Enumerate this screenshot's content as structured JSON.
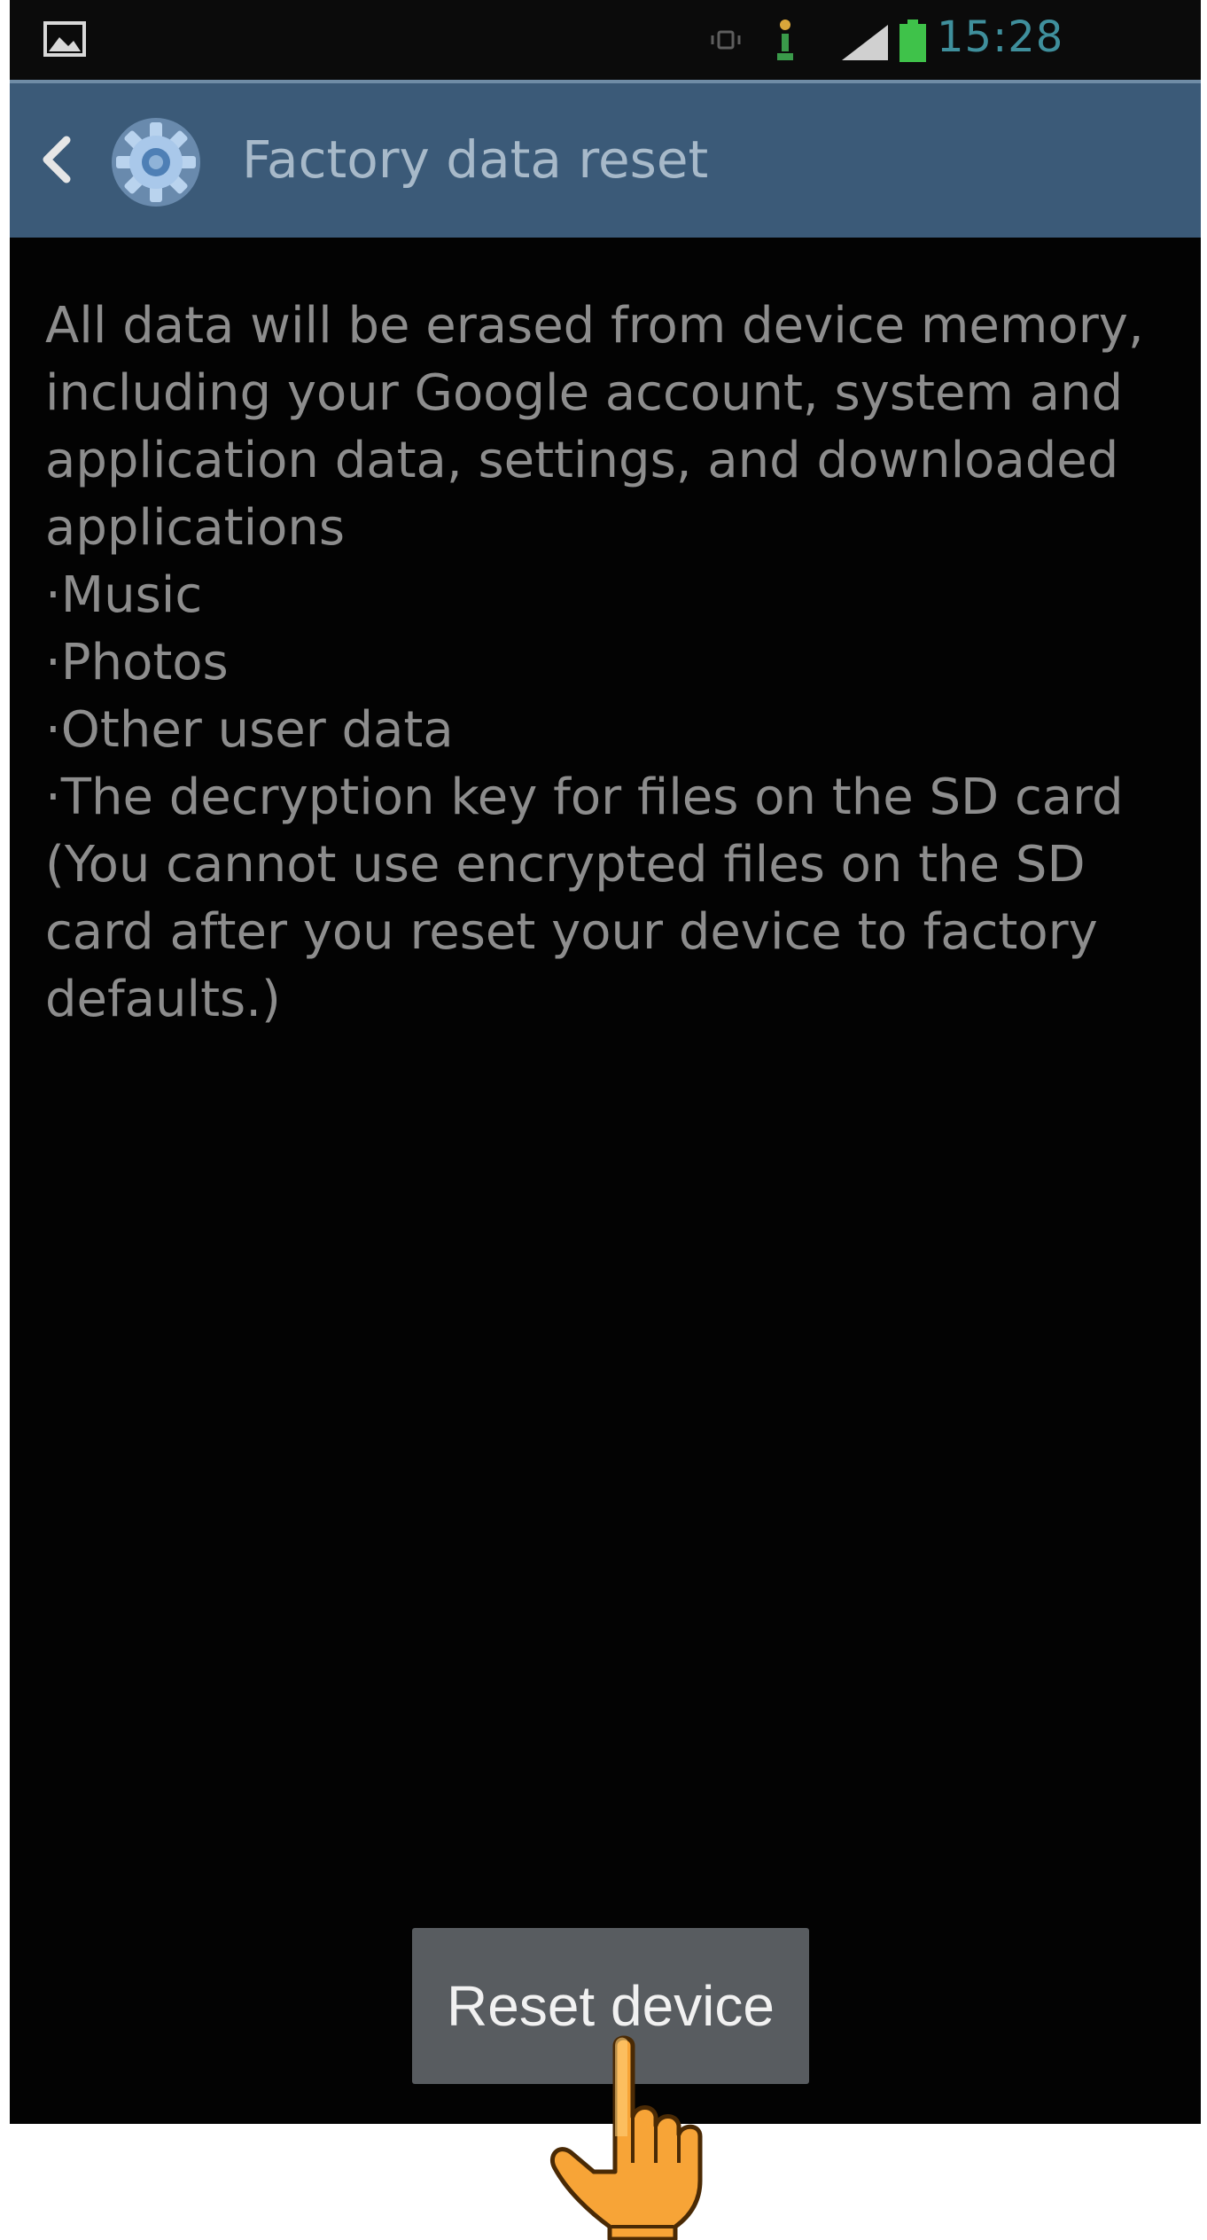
{
  "status_bar": {
    "time": "15:28",
    "icons": [
      "gallery-icon",
      "vibrate-icon",
      "alarm-icon",
      "signal-icon",
      "battery-icon"
    ]
  },
  "action_bar": {
    "title": "Factory data reset",
    "back_icon": "chevron-left-icon",
    "app_icon": "settings-gear-icon",
    "background": "#3b5a78"
  },
  "content": {
    "intro": "All data will be erased from device memory, including your Google account, system and application data, settings, and downloaded applications",
    "items": [
      "·Music",
      "·Photos",
      "·Other user data",
      "·The decryption key for files on the SD card"
    ],
    "note": "(You cannot use encrypted files on the SD card after you reset your device to factory defaults.)"
  },
  "button": {
    "label": "Reset device"
  },
  "colors": {
    "screen_background": "#030303",
    "body_text": "#8d8d8d",
    "button_background": "#585c60",
    "cursor_fill": "#f7a437"
  },
  "cursor_icon": "pointing-hand-icon"
}
